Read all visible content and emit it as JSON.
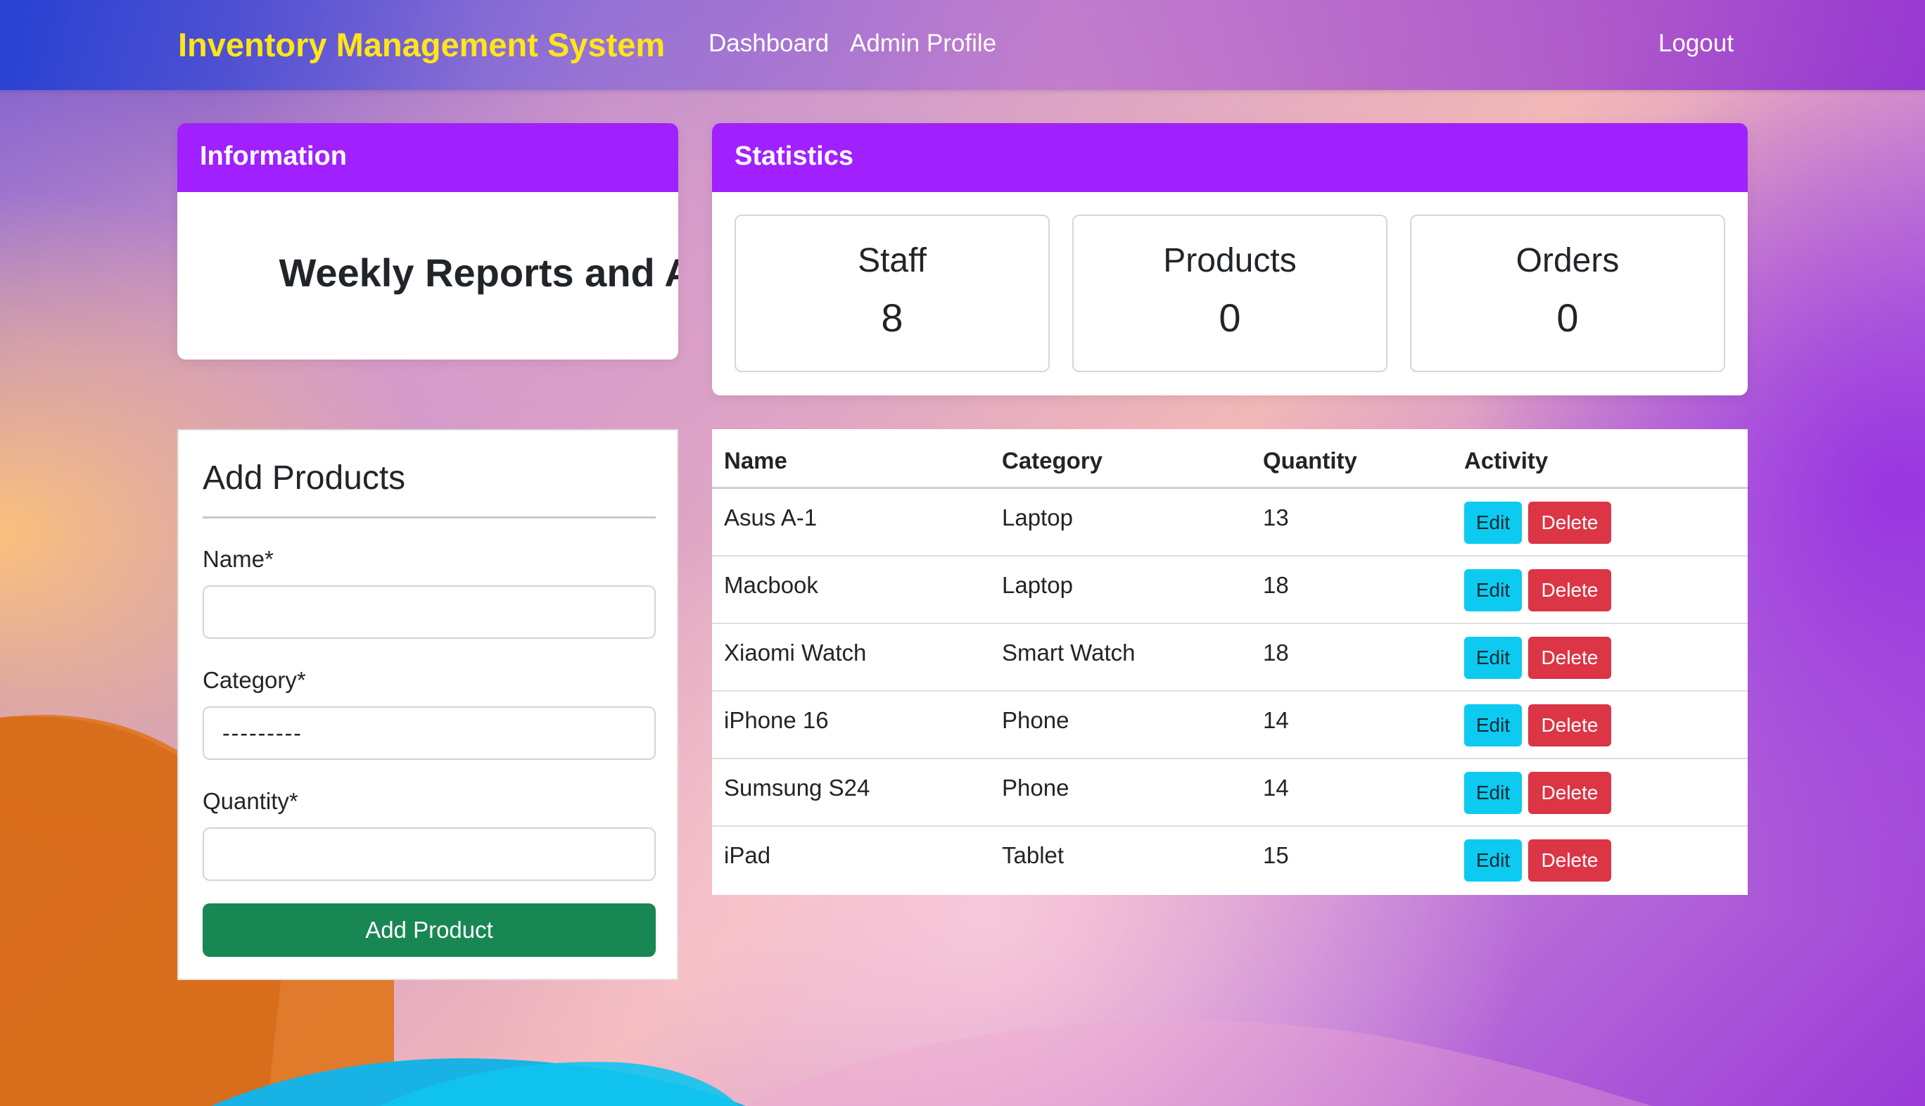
{
  "navbar": {
    "brand": "Inventory Management System",
    "links": [
      "Dashboard",
      "Admin Profile"
    ],
    "logout": "Logout"
  },
  "information": {
    "title": "Information",
    "marquee_text": "Weekly Reports and Analyzes"
  },
  "statistics": {
    "title": "Statistics",
    "items": [
      {
        "label": "Staff",
        "value": "8"
      },
      {
        "label": "Products",
        "value": "0"
      },
      {
        "label": "Orders",
        "value": "0"
      }
    ]
  },
  "add_products": {
    "title": "Add Products",
    "fields": {
      "name": {
        "label": "Name*",
        "value": ""
      },
      "category": {
        "label": "Category*",
        "value": "---------"
      },
      "quantity": {
        "label": "Quantity*",
        "value": ""
      }
    },
    "submit_label": "Add Product"
  },
  "products_table": {
    "headers": [
      "Name",
      "Category",
      "Quantity",
      "Activity"
    ],
    "rows": [
      {
        "name": "Asus A-1",
        "category": "Laptop",
        "quantity": "13"
      },
      {
        "name": "Macbook",
        "category": "Laptop",
        "quantity": "18"
      },
      {
        "name": "Xiaomi Watch",
        "category": "Smart Watch",
        "quantity": "18"
      },
      {
        "name": "iPhone 16",
        "category": "Phone",
        "quantity": "14"
      },
      {
        "name": "Sumsung S24",
        "category": "Phone",
        "quantity": "14"
      },
      {
        "name": "iPad",
        "category": "Tablet",
        "quantity": "15"
      }
    ],
    "edit_label": "Edit",
    "delete_label": "Delete"
  },
  "colors": {
    "brand_text": "#ffe51a",
    "card_header": "#a020ff",
    "add_button": "#198754",
    "edit_button": "#0dcaf0",
    "delete_button": "#dc3545"
  }
}
